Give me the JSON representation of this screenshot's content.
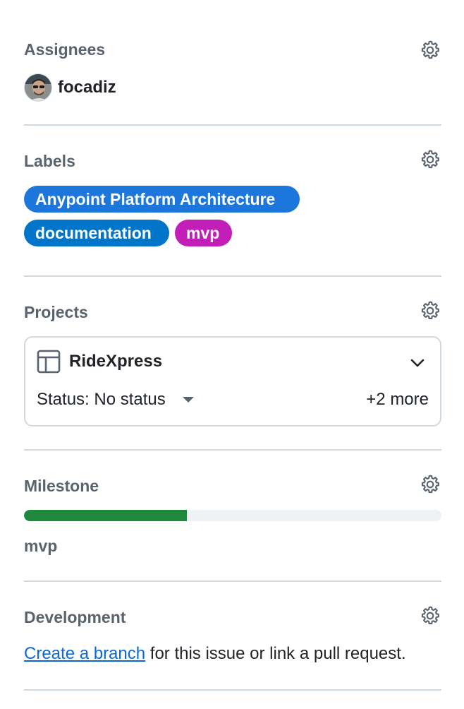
{
  "assignees": {
    "heading": "Assignees",
    "user": {
      "name": "focadiz"
    }
  },
  "labels": {
    "heading": "Labels",
    "items": [
      {
        "text": "Anypoint Platform Architecture",
        "color": "#1d76db"
      },
      {
        "text": "documentation",
        "color": "#0075ca"
      },
      {
        "text": "mvp",
        "color": "#c21fb8"
      }
    ]
  },
  "projects": {
    "heading": "Projects",
    "card": {
      "name": "RideXpress",
      "status": "Status: No status",
      "more": "+2 more"
    }
  },
  "milestone": {
    "heading": "Milestone",
    "progress": 0.39,
    "name": "mvp",
    "colors": {
      "fill": "#1f883d",
      "track": "#eff2f5"
    }
  },
  "development": {
    "heading": "Development",
    "link_text": "Create a branch",
    "rest_text": " for this issue or link a pull request."
  },
  "icons": {
    "settings": "gear-icon",
    "project": "table-icon",
    "expand": "chevron-down-icon",
    "status_dropdown": "triangle-down-icon"
  }
}
